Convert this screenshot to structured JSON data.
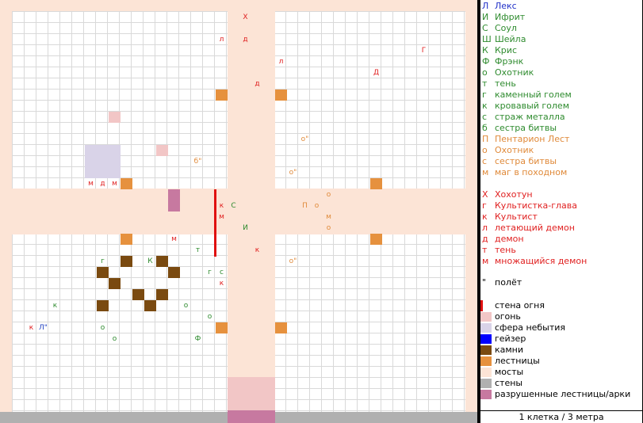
{
  "map": {
    "colors": {
      "bridge": "#fce4d6",
      "stairs": "#e6913e",
      "fire": "#f2c6c6",
      "void": "#d9d3e8",
      "rocks": "#7a4a10",
      "wall": "#b0b0b0",
      "broken": "#c779a0",
      "firewall": "#e01010"
    },
    "tokens": [
      {
        "label": "Х",
        "color": "#e02020"
      },
      {
        "label": "л",
        "color": "#e02020"
      },
      {
        "label": "д",
        "color": "#e02020"
      },
      {
        "label": "Г",
        "color": "#e02020"
      },
      {
        "label": "л",
        "color": "#e02020"
      },
      {
        "label": "Д",
        "color": "#e02020"
      },
      {
        "label": "д",
        "color": "#e02020"
      },
      {
        "label": "о\"",
        "color": "#e08a3a"
      },
      {
        "label": "б\"",
        "color": "#e08a3a"
      },
      {
        "label": "о\"",
        "color": "#e08a3a"
      },
      {
        "label": "м",
        "color": "#e02020"
      },
      {
        "label": "д",
        "color": "#e02020"
      },
      {
        "label": "м",
        "color": "#e02020"
      },
      {
        "label": "о",
        "color": "#e08a3a"
      },
      {
        "label": "к",
        "color": "#e02020"
      },
      {
        "label": "С",
        "color": "#2e8b2e"
      },
      {
        "label": "П",
        "color": "#e08a3a"
      },
      {
        "label": "о",
        "color": "#e08a3a"
      },
      {
        "label": "м",
        "color": "#e02020"
      },
      {
        "label": "м",
        "color": "#e08a3a"
      },
      {
        "label": "И",
        "color": "#2e8b2e"
      },
      {
        "label": "о",
        "color": "#e08a3a"
      },
      {
        "label": "м",
        "color": "#e02020"
      },
      {
        "label": "т",
        "color": "#2e8b2e"
      },
      {
        "label": "к",
        "color": "#e02020"
      },
      {
        "label": "г",
        "color": "#2e8b2e"
      },
      {
        "label": "К",
        "color": "#2e8b2e"
      },
      {
        "label": "о\"",
        "color": "#e08a3a"
      },
      {
        "label": "г",
        "color": "#2e8b2e"
      },
      {
        "label": "с",
        "color": "#2e8b2e"
      },
      {
        "label": "к",
        "color": "#e02020"
      },
      {
        "label": "к",
        "color": "#2e8b2e"
      },
      {
        "label": "о",
        "color": "#2e8b2e"
      },
      {
        "label": "о",
        "color": "#2e8b2e"
      },
      {
        "label": "к",
        "color": "#e02020"
      },
      {
        "label": "Л\"",
        "color": "#2040c0"
      },
      {
        "label": "о",
        "color": "#2e8b2e"
      },
      {
        "label": "о",
        "color": "#2e8b2e"
      },
      {
        "label": "Ф",
        "color": "#2e8b2e"
      }
    ]
  },
  "legend": {
    "characters": [
      {
        "sym": "Л",
        "name": "Лекс",
        "color": "#2030c8"
      },
      {
        "sym": "И",
        "name": "Ифрит",
        "color": "#2e8b2e"
      },
      {
        "sym": "С",
        "name": "Соул",
        "color": "#2e8b2e"
      },
      {
        "sym": "Ш",
        "name": "Шейла",
        "color": "#2e8b2e"
      },
      {
        "sym": "К",
        "name": "Крис",
        "color": "#2e8b2e"
      },
      {
        "sym": "Ф",
        "name": "Фрэнк",
        "color": "#2e8b2e"
      },
      {
        "sym": "о",
        "name": "Охотник",
        "color": "#2e8b2e"
      },
      {
        "sym": "т",
        "name": "тень",
        "color": "#2e8b2e"
      },
      {
        "sym": "г",
        "name": "каменный голем",
        "color": "#2e8b2e"
      },
      {
        "sym": "к",
        "name": "кровавый голем",
        "color": "#2e8b2e"
      },
      {
        "sym": "с",
        "name": "страж металла",
        "color": "#2e8b2e"
      },
      {
        "sym": "б",
        "name": "сестра битвы",
        "color": "#2e8b2e"
      },
      {
        "sym": "П",
        "name": "Пентарион Лест",
        "color": "#e08a3a"
      },
      {
        "sym": "о",
        "name": "Охотник",
        "color": "#e08a3a"
      },
      {
        "sym": "с",
        "name": "сестра битвы",
        "color": "#e08a3a"
      },
      {
        "sym": "м",
        "name": "маг в походном",
        "color": "#e08a3a"
      }
    ],
    "enemies": [
      {
        "sym": "Х",
        "name": "Хохотун",
        "color": "#e02020"
      },
      {
        "sym": "г",
        "name": "Культистка-глава",
        "color": "#e02020"
      },
      {
        "sym": "к",
        "name": "Культист",
        "color": "#e02020"
      },
      {
        "sym": "л",
        "name": "летающий демон",
        "color": "#e02020"
      },
      {
        "sym": "д",
        "name": "демон",
        "color": "#e02020"
      },
      {
        "sym": "т",
        "name": "тень",
        "color": "#e02020"
      },
      {
        "sym": "м",
        "name": "множащийся демон",
        "color": "#e02020"
      }
    ],
    "flight": {
      "sym": "\"",
      "name": "полёт"
    },
    "terrain": [
      {
        "name": "стена огня",
        "color": "#e01010",
        "kind": "line"
      },
      {
        "name": "огонь",
        "color": "#f2c6c6"
      },
      {
        "name": "сфера небытия",
        "color": "#d9d3e8"
      },
      {
        "name": "гейзер",
        "color": "#0000ff"
      },
      {
        "name": "камни",
        "color": "#7a4a10"
      },
      {
        "name": "лестницы",
        "color": "#e6913e"
      },
      {
        "name": "мосты",
        "color": "#fce4d6"
      },
      {
        "name": "стены",
        "color": "#b0b0b0"
      },
      {
        "name": "разрушенные лестницы/арки",
        "color": "#c779a0"
      }
    ],
    "scale": "1 клетка / 3 метра"
  }
}
